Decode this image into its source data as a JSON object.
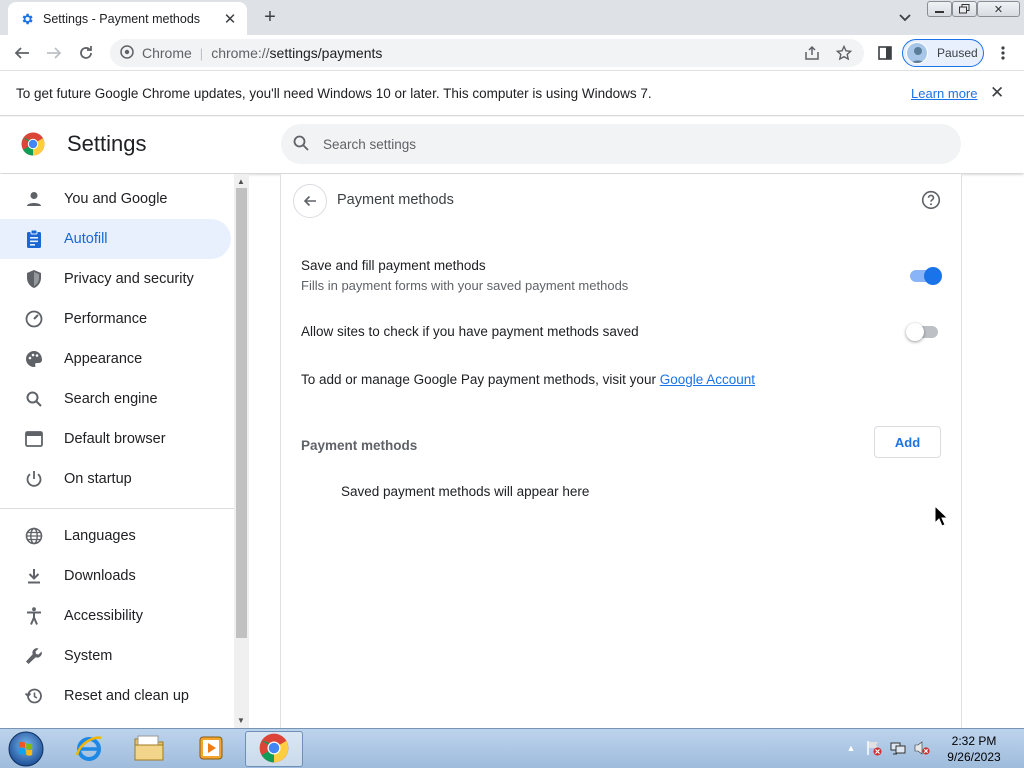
{
  "browser": {
    "tab_title": "Settings - Payment methods",
    "omnibox_site": "Chrome",
    "omnibox_url_prefix": "chrome://",
    "omnibox_url_path": "settings/payments",
    "profile_label": "Paused"
  },
  "infobar": {
    "message": "To get future Google Chrome updates, you'll need Windows 10 or later. This computer is using Windows 7.",
    "learn_more": "Learn more"
  },
  "settings": {
    "title": "Settings",
    "search_placeholder": "Search settings"
  },
  "sidebar": {
    "items": [
      {
        "label": "You and Google",
        "icon": "person-icon"
      },
      {
        "label": "Autofill",
        "icon": "clipboard-icon",
        "active": true
      },
      {
        "label": "Privacy and security",
        "icon": "shield-icon"
      },
      {
        "label": "Performance",
        "icon": "speedometer-icon"
      },
      {
        "label": "Appearance",
        "icon": "palette-icon"
      },
      {
        "label": "Search engine",
        "icon": "search-icon"
      },
      {
        "label": "Default browser",
        "icon": "browser-window-icon"
      },
      {
        "label": "On startup",
        "icon": "power-icon"
      },
      {
        "label": "Languages",
        "icon": "globe-icon"
      },
      {
        "label": "Downloads",
        "icon": "download-icon"
      },
      {
        "label": "Accessibility",
        "icon": "accessibility-icon"
      },
      {
        "label": "System",
        "icon": "wrench-icon"
      },
      {
        "label": "Reset and clean up",
        "icon": "history-icon"
      }
    ]
  },
  "main": {
    "page_title": "Payment methods",
    "save_fill_title": "Save and fill payment methods",
    "save_fill_sub": "Fills in payment forms with your saved payment methods",
    "save_fill_enabled": true,
    "allow_sites_title": "Allow sites to check if you have payment methods saved",
    "allow_sites_enabled": false,
    "gpay_text": "To add or manage Google Pay payment methods, visit your ",
    "gpay_link": "Google Account",
    "payment_methods_label": "Payment methods",
    "add_button": "Add",
    "empty_text": "Saved payment methods will appear here"
  },
  "taskbar": {
    "time": "2:32 PM",
    "date": "9/26/2023"
  },
  "colors": {
    "accent": "#1a73e8",
    "active_nav_bg": "#e8f0fe",
    "toggle_on": "#1a73e8"
  }
}
